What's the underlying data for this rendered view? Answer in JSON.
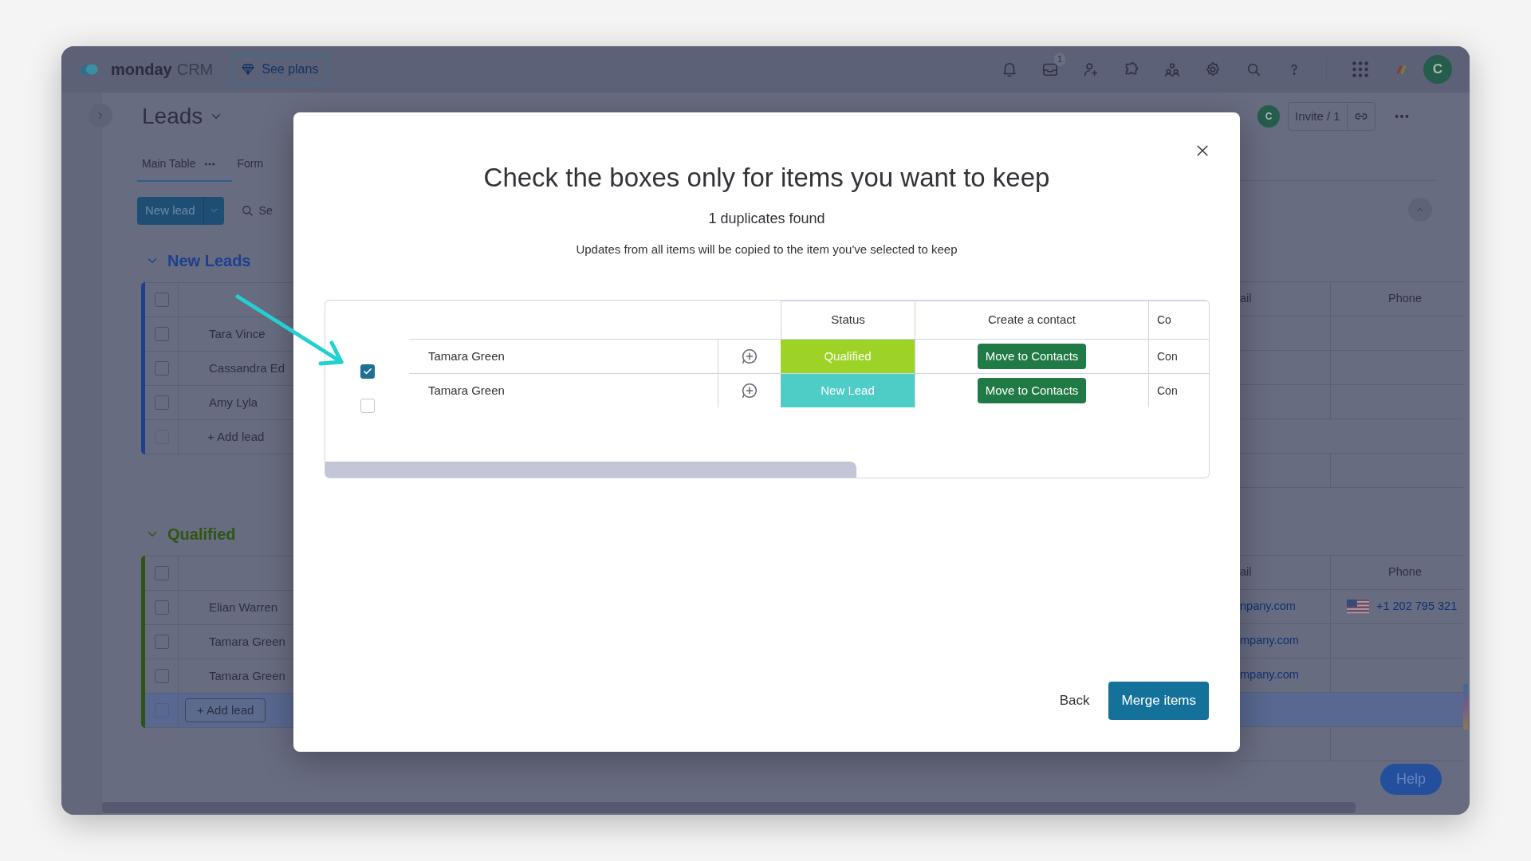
{
  "topbar": {
    "brand": "monday",
    "product": "CRM",
    "plans_button": "See plans",
    "inbox_badge": "1",
    "avatar": "C"
  },
  "board": {
    "title": "Leads",
    "views": [
      {
        "label": "Main Table",
        "selected": true
      },
      {
        "label": "Form",
        "selected": false
      }
    ],
    "new_button": "New lead",
    "search": "Se",
    "avatar": "C",
    "invite": "Invite / 1"
  },
  "groups": [
    {
      "title": "New Leads",
      "color": "#1d3f8f",
      "select_all": false,
      "columns": {
        "email": "ail",
        "phone": "Phone"
      },
      "rows": [
        {
          "name": "Tara Vince",
          "checked": false
        },
        {
          "name": "Cassandra Ed",
          "checked": false
        },
        {
          "name": "Amy Lyla",
          "checked": false
        }
      ],
      "add_row": {
        "label": "+ Add lead",
        "checked": false,
        "highlighted": false
      }
    },
    {
      "title": "Qualified",
      "color": "#2f5512",
      "select_all": false,
      "columns": {
        "email": "ail",
        "phone": "Phone"
      },
      "rows": [
        {
          "name": "Elian Warren",
          "checked": false,
          "email": "npany.com",
          "phone": "+1 202 795 321"
        },
        {
          "name": "Tamara Green",
          "checked": false,
          "email": "mpany.com"
        },
        {
          "name": "Tamara Green",
          "checked": false,
          "email": "mpany.com"
        }
      ],
      "add_row": {
        "label": "+ Add lead",
        "checked": false,
        "highlighted": true
      }
    }
  ],
  "help_button": "Help",
  "dialog": {
    "title": "Check the boxes only for items you want to keep",
    "count": "1 duplicates found",
    "note": "Updates from all items will be copied to the item you've selected to keep",
    "columns": [
      "Status",
      "Create a contact",
      "Co"
    ],
    "items": [
      {
        "name": "Tamara Green",
        "checked": true,
        "status": "Qualified",
        "color": "#9cd326",
        "action": "Move to Contacts",
        "column_3": "Con"
      },
      {
        "name": "Tamara Green",
        "checked": false,
        "status": "New Lead",
        "color": "#4eccc6",
        "action": "Move to Contacts",
        "column_3": "Con"
      }
    ],
    "back": "Back",
    "merge": "Merge items"
  }
}
